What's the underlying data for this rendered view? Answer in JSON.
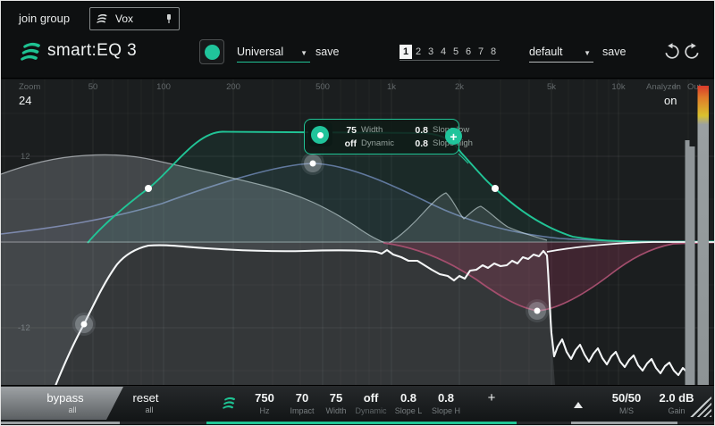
{
  "header": {
    "join_group_label": "join group",
    "group_name": "Vox",
    "logo_text": "smart:EQ 3",
    "profile": {
      "value": "Universal",
      "save_label": "save"
    },
    "patterns": {
      "items": [
        "1",
        "2",
        "3",
        "4",
        "5",
        "6",
        "7",
        "8"
      ],
      "active": "1"
    },
    "preset": {
      "value": "default",
      "save_label": "save"
    }
  },
  "graph": {
    "zoom": {
      "label": "Zoom",
      "value": "24"
    },
    "freq_ticks": [
      "50",
      "100",
      "200",
      "500",
      "1k",
      "2k",
      "5k",
      "10k"
    ],
    "db_ticks": [
      "12",
      "-12"
    ],
    "analyzer": {
      "label": "Analyzer",
      "value": "on"
    },
    "meters": {
      "in_label": "In",
      "out_label": "Out"
    },
    "band_tooltip": {
      "width": {
        "value": "75",
        "label": "Width"
      },
      "dynamic": {
        "value": "off",
        "label": "Dynamic"
      },
      "slope_low": {
        "value": "0.8",
        "label": "Slope low"
      },
      "slope_high": {
        "value": "0.8",
        "label": "Slope high"
      },
      "add_label": "+"
    }
  },
  "footer": {
    "bypass": {
      "label": "bypass",
      "scope": "all"
    },
    "reset": {
      "label": "reset",
      "scope": "all"
    },
    "band_params": [
      {
        "value": "750",
        "label": "Hz"
      },
      {
        "value": "70",
        "label": "Impact"
      },
      {
        "value": "75",
        "label": "Width"
      },
      {
        "value": "off",
        "label": "Dynamic"
      },
      {
        "value": "0.8",
        "label": "Slope L"
      },
      {
        "value": "0.8",
        "label": "Slope H"
      }
    ],
    "add_band_label": "+",
    "ms": {
      "value": "50/50",
      "label": "M/S"
    },
    "gain": {
      "value": "2.0 dB",
      "label": "Gain"
    }
  },
  "colors": {
    "accent": "#20c49b",
    "band_blue": "#66739f",
    "band_pink": "#a34e6d",
    "meter_top": "#d93a2b"
  }
}
